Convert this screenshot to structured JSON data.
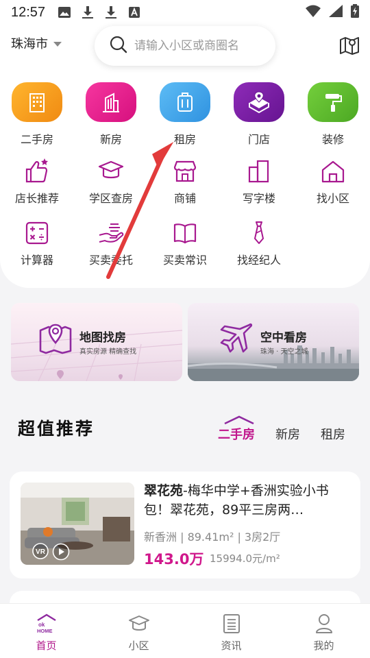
{
  "status_bar": {
    "time": "12:57",
    "icons": [
      "image-icon",
      "download-icon",
      "download-icon",
      "text-a-icon",
      "wifi-icon",
      "signal-icon",
      "battery-charging-icon"
    ]
  },
  "header": {
    "city": "珠海市",
    "search_placeholder": "请输入小区或商圈名",
    "map_icon": "map-pin-icon"
  },
  "main_categories": [
    {
      "label": "二手房",
      "icon": "building-icon",
      "color": "#f59a1c"
    },
    {
      "label": "新房",
      "icon": "tower-icon",
      "color": "#e8148e"
    },
    {
      "label": "租房",
      "icon": "suitcase-icon",
      "color": "#3fa6ec"
    },
    {
      "label": "门店",
      "icon": "store-pin-icon",
      "color": "#7b1fa2"
    },
    {
      "label": "装修",
      "icon": "paint-roller-icon",
      "color": "#5cb82a"
    }
  ],
  "secondary_row1": [
    {
      "label": "店长推荐",
      "icon": "thumbs-up-icon"
    },
    {
      "label": "学区查房",
      "icon": "graduation-cap-icon"
    },
    {
      "label": "商铺",
      "icon": "shop-icon"
    },
    {
      "label": "写字楼",
      "icon": "office-icon"
    },
    {
      "label": "找小区",
      "icon": "house-outline-icon"
    }
  ],
  "secondary_row2": [
    {
      "label": "计算器",
      "icon": "calculator-icon"
    },
    {
      "label": "买卖委托",
      "icon": "hand-money-icon"
    },
    {
      "label": "买卖常识",
      "icon": "book-icon"
    },
    {
      "label": "找经纪人",
      "icon": "tie-icon"
    }
  ],
  "banners": [
    {
      "title": "地图找房",
      "subtitle": "真实房源 精确查找"
    },
    {
      "title": "空中看房",
      "subtitle": "珠海 · 天空之城"
    }
  ],
  "recommend": {
    "title": "超值推荐",
    "tabs": [
      "二手房",
      "新房",
      "租房"
    ],
    "active_tab": "二手房"
  },
  "listing": {
    "title_bold": "翠花苑",
    "title_rest": "-梅华中学+香洲实验小书包！翠花苑，89平三房两…",
    "meta": "新香洲 | 89.41m² | 3房2厅",
    "price": "143.0万",
    "unit_price": "15994.0元/m²",
    "badge": "VR"
  },
  "bottom_nav": [
    {
      "label": "首页",
      "icon": "home-logo-icon",
      "active": true
    },
    {
      "label": "小区",
      "icon": "graduation-cap-icon",
      "active": false
    },
    {
      "label": "资讯",
      "icon": "document-icon",
      "active": false
    },
    {
      "label": "我的",
      "icon": "user-icon",
      "active": false
    }
  ],
  "colors": {
    "brand": "#c0168c",
    "arrow": "#e23b3b"
  }
}
